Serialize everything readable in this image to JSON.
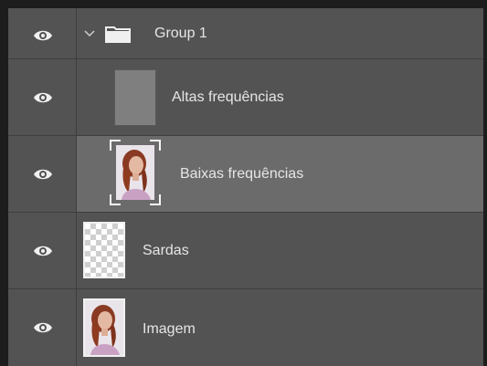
{
  "layers_panel": {
    "layers": [
      {
        "name": "Group 1",
        "type": "group",
        "expanded": true,
        "visible": true,
        "eye_icon": "eye-icon",
        "chevron_icon": "chevron-down-icon",
        "folder_icon": "folder-icon"
      },
      {
        "name": "Altas frequências",
        "type": "layer",
        "visible": true,
        "thumbnail": "grey-fill",
        "indented": true
      },
      {
        "name": "Baixas frequências",
        "type": "smart-object",
        "visible": true,
        "selected": true,
        "thumbnail": "portrait",
        "indented": true
      },
      {
        "name": "Sardas",
        "type": "layer",
        "visible": true,
        "thumbnail": "transparent"
      },
      {
        "name": "Imagem",
        "type": "layer",
        "visible": true,
        "thumbnail": "portrait"
      }
    ],
    "colors": {
      "panel_bg": "#535353",
      "selected_bg": "#6b6b6b",
      "text": "#e6e6e6",
      "border": "#3e3e3e"
    }
  }
}
